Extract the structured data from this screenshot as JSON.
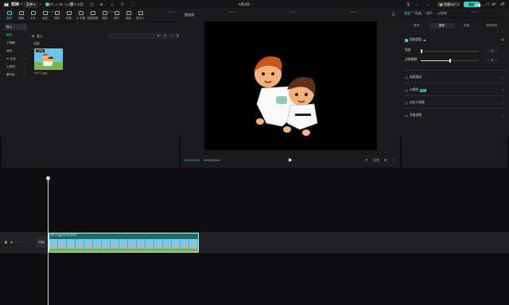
{
  "app": {
    "name": "剪映",
    "menu_label": "菜单",
    "autosave": "22:57:14 自动保存本地",
    "doc_title": "1月4日",
    "vip_label": "👑 剪映VIP",
    "export_label": "导出",
    "window_controls": [
      "—",
      "□",
      "✕"
    ]
  },
  "media": {
    "tabs": [
      {
        "label": "素材",
        "icon": "media-icon",
        "active": true
      },
      {
        "label": "音频",
        "icon": "audio-icon"
      },
      {
        "label": "文本",
        "icon": "text-icon"
      },
      {
        "label": "贴纸",
        "icon": "sticker-icon"
      },
      {
        "label": "特效",
        "icon": "effects-icon"
      },
      {
        "label": "转场",
        "icon": "transition-icon"
      },
      {
        "label": "AI 字幕",
        "icon": "caption-icon"
      },
      {
        "label": "智能剪辑",
        "icon": "smart-edit-icon"
      },
      {
        "label": "滤镜",
        "icon": "filter-icon"
      },
      {
        "label": "调节",
        "icon": "adjust-icon"
      },
      {
        "label": "模板",
        "icon": "template-icon"
      },
      {
        "label": "数字人",
        "icon": "avatar-icon"
      }
    ],
    "nav": [
      {
        "label": "导入",
        "chev": "▾",
        "selected": true
      },
      {
        "label": "素材",
        "accent": true
      },
      {
        "label": "子草稿"
      },
      {
        "label": "我的",
        "chev": "▸"
      },
      {
        "label": "AI 生成",
        "chev": "▸"
      },
      {
        "label": "云素材",
        "chev": "▸"
      },
      {
        "label": "素材库",
        "chev": "▸"
      }
    ],
    "import_label": "导入",
    "tools": [
      "⇅",
      "☰",
      "≡",
      "⊞"
    ],
    "folder_label": "全部",
    "thumb_badge": "已添加",
    "thumb_name": "DIF-C.jpg"
  },
  "player": {
    "title": "播放器",
    "menu": "☰",
    "timecode_current": "00:00:00:00",
    "timecode_total": "00:00:05:00",
    "controls": [
      "⊡",
      "比例",
      "⊞",
      "⛶"
    ]
  },
  "props": {
    "tabs": [
      "画面",
      "动画",
      "调节",
      "AI效果"
    ],
    "sub_tabs": [
      "基础",
      "抠像",
      "蒙版",
      "美颜美体"
    ],
    "rows": [
      {
        "label": "智能抠图",
        "checked": true
      },
      {
        "label": "强度",
        "value": "0"
      },
      {
        "label": "边缘模糊",
        "value": "0"
      },
      {
        "label": "画面描边",
        "checked": false
      },
      {
        "label": "AI抠图",
        "badge": "限免",
        "checked": false
      },
      {
        "label": "自定义抠像",
        "checked": false
      },
      {
        "label": "色度抠图",
        "checked": false
      }
    ]
  },
  "timeline": {
    "ruler_ticks": [
      "00:00",
      "00:05",
      "00:10",
      "00:15",
      "00:20",
      "00:25",
      "00:30",
      "00:35",
      "00:40"
    ],
    "cover_label": "封面",
    "clip_label": "DIF-C.jpg  00:00:05:00"
  }
}
